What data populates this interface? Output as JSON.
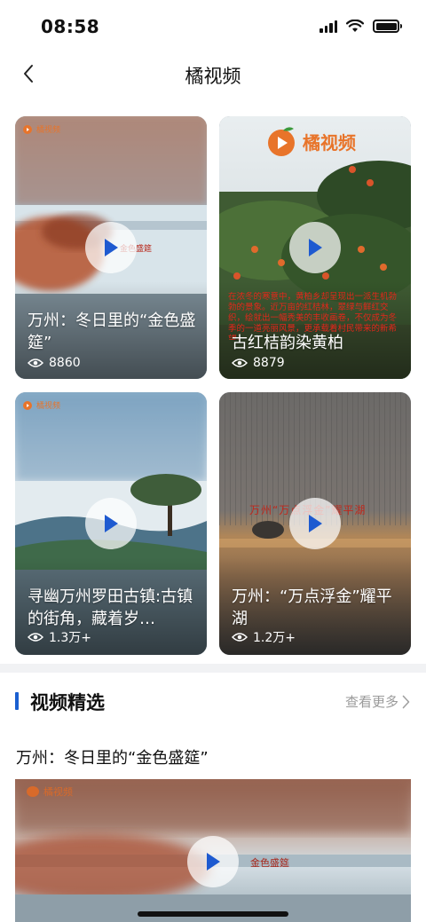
{
  "status_bar": {
    "time": "08:58"
  },
  "nav": {
    "title": "橘视频"
  },
  "brand": {
    "logo_text": "橘视频",
    "logo_color": "#e8742a",
    "accent": "#1a5fd0"
  },
  "cards": [
    {
      "title": "万州：冬日里的“金色盛筵”",
      "views": "8860",
      "overlay_text": "金色盛筵"
    },
    {
      "title": "古红桔韵染黄柏",
      "views": "8879",
      "overlay_text": "在浓冬的寒意中，黄柏乡却呈现出一派生机勃勃的景象。近万亩的红桔林，翠绿与鲜红交织，绘就出一幅秀美的丰收画卷，不仅成为冬季的一道亮丽风景，更承载着村民带来的新希望。"
    },
    {
      "title": "寻幽万州罗田古镇:古镇的街角，藏着岁…",
      "views": "1.3万+"
    },
    {
      "title": "万州：“万点浮金”耀平湖",
      "views": "1.2万+",
      "overlay_text": "万州“万点浮金”耀平湖"
    }
  ],
  "section": {
    "title": "视频精选",
    "see_more": "查看更多"
  },
  "featured": {
    "title": "万州：冬日里的“金色盛筵”",
    "overlay_text": "金色盛筵"
  }
}
